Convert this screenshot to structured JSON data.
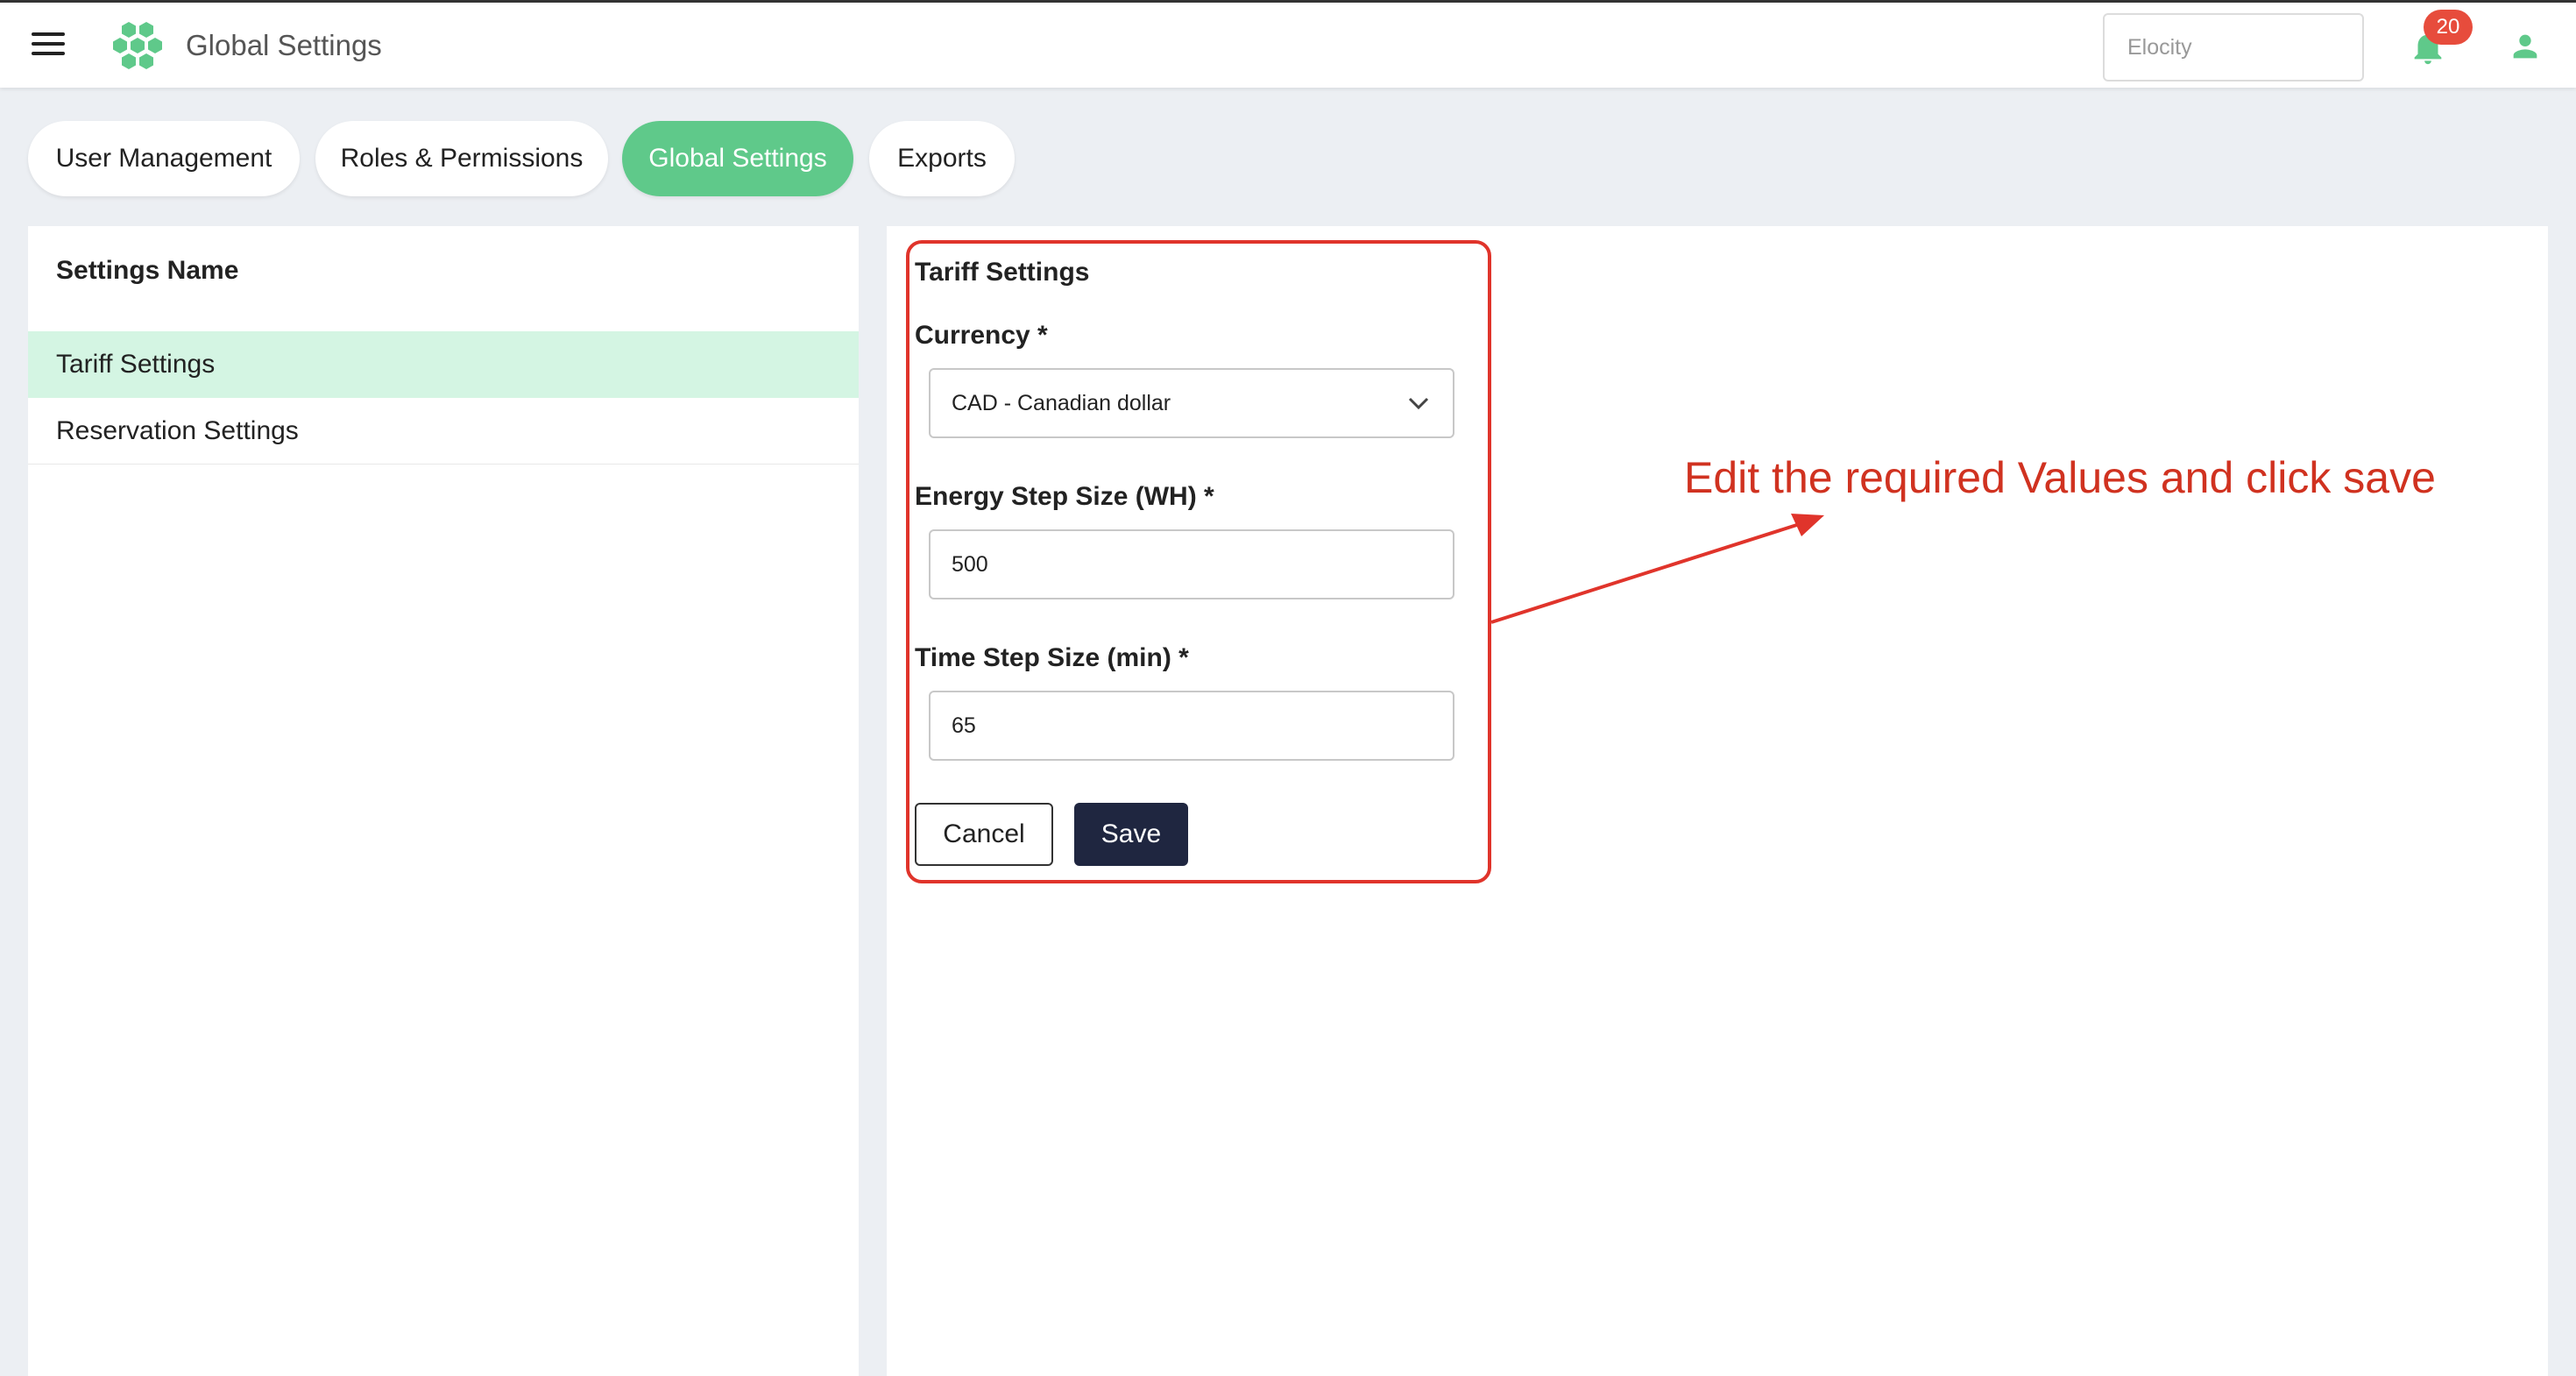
{
  "header": {
    "title": "Global Settings",
    "search_placeholder": "Elocity",
    "notification_count": "20"
  },
  "tabs": [
    {
      "label": "User Management",
      "active": false
    },
    {
      "label": "Roles & Permissions",
      "active": false
    },
    {
      "label": "Global Settings",
      "active": true
    },
    {
      "label": "Exports",
      "active": false
    }
  ],
  "settings_list": {
    "header": "Settings Name",
    "items": [
      {
        "label": "Tariff Settings",
        "selected": true
      },
      {
        "label": "Reservation Settings",
        "selected": false
      }
    ]
  },
  "form": {
    "title": "Tariff Settings",
    "currency_label": "Currency *",
    "currency_value": "CAD - Canadian dollar",
    "energy_label": "Energy Step Size (WH) *",
    "energy_value": "500",
    "time_label": "Time Step Size (min) *",
    "time_value": "65",
    "cancel_label": "Cancel",
    "save_label": "Save"
  },
  "annotation": {
    "text": "Edit the required Values and click save"
  },
  "colors": {
    "accent_green": "#5fc98a",
    "selected_row": "#d4f5e3",
    "save_button": "#1f2640",
    "annotation_red": "#d03220",
    "badge_red": "#e74c3c"
  }
}
